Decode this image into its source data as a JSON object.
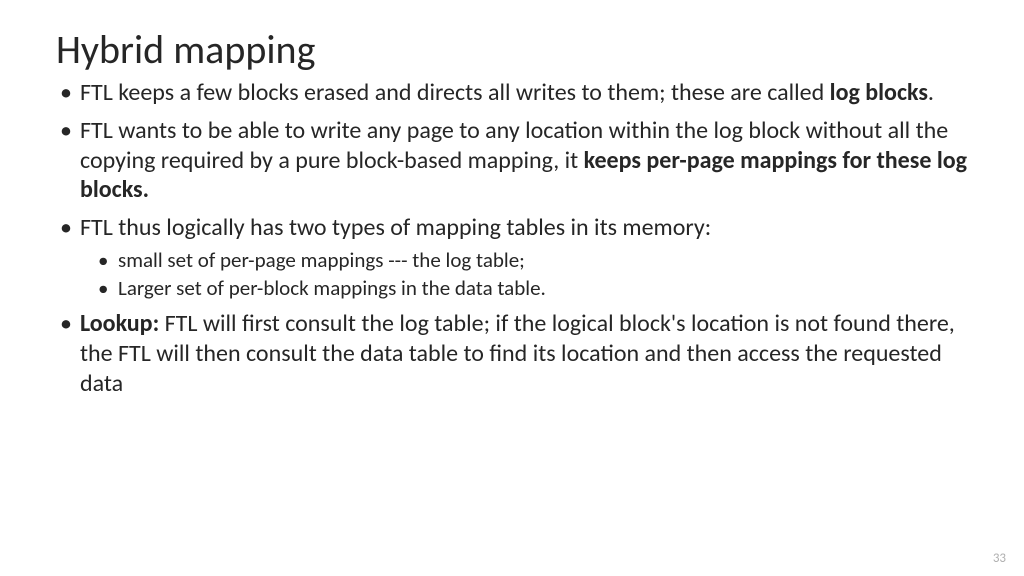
{
  "title": "Hybrid mapping",
  "bullets": {
    "b1a": "FTL keeps a few blocks erased and directs all writes to them; these are called ",
    "b1b": "log blocks",
    "b1c": ".",
    "b2a": "FTL wants to be able to write any page to any location within the log block without all the copying required by a pure block-based mapping, it ",
    "b2b": "keeps per-page mappings for these log blocks.",
    "b3": "FTL thus logically has two types of mapping tables in its memory:",
    "b3_1": "small set of per-page mappings --- the log table;",
    "b3_2": "Larger set of per-block mappings in the data table.",
    "b4a": "Lookup:",
    "b4b": " FTL will first consult the log table; if the logical block's location is not found there, the FTL will then consult the data table to find its location and then access the requested data"
  },
  "page_number": "33"
}
